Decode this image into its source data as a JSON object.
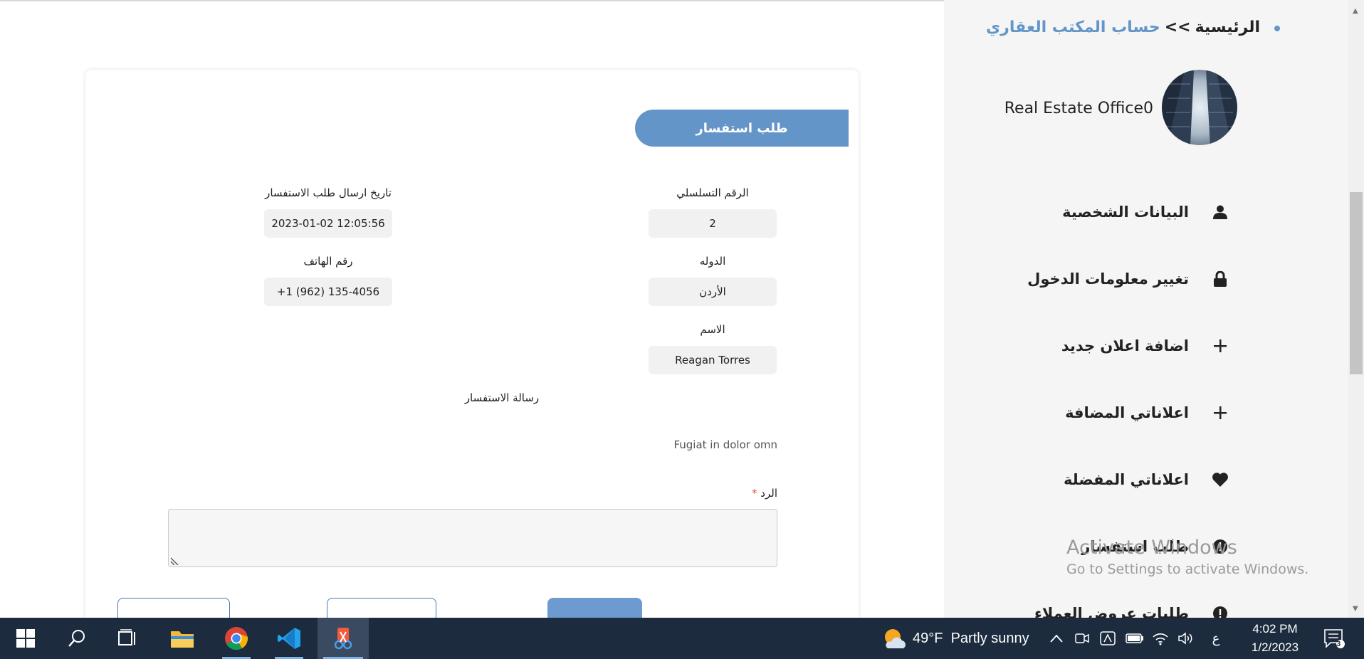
{
  "breadcrumb": {
    "home": "الرئيسية",
    "separator": ">>",
    "current": "حساب المكتب العقاري"
  },
  "profile": {
    "office_name": "Real Estate Office0",
    "avatar_icon": "building-photo"
  },
  "menu": [
    {
      "label": "البيانات الشخصية",
      "icon": "user-icon"
    },
    {
      "label": "تغيير معلومات الدخول",
      "icon": "lock-icon"
    },
    {
      "label": "اضافة اعلان جديد",
      "icon": "plus-icon"
    },
    {
      "label": "اعلاناتي المضافة",
      "icon": "plus-icon"
    },
    {
      "label": "اعلاناتي المفضلة",
      "icon": "heart-icon"
    },
    {
      "label": "طلب استفسار",
      "icon": "info-icon"
    },
    {
      "label": "طلبات عروض العملاء",
      "icon": "info-icon"
    }
  ],
  "inquiry": {
    "tab_title": "طلب استفسار",
    "serial_label": "الرقم التسلسلي",
    "serial_value": "2",
    "date_label": "تاريخ ارسال طلب الاستفسار",
    "date_value": "2023-01-02 12:05:56",
    "country_label": "الدوله",
    "country_value": "الأردن",
    "phone_label": "رقم الهاتف",
    "phone_value": "+1 (962) 135-4056",
    "name_label": "الاسم",
    "name_value": "Reagan Torres",
    "message_label": "رسالة الاستفسار",
    "message_value": "Fugiat in dolor omn",
    "reply_label": "الرد",
    "reply_required": "*"
  },
  "watermark": {
    "title": "Activate Windows",
    "subtitle": "Go to Settings to activate Windows."
  },
  "taskbar": {
    "weather_temp": "49°F",
    "weather_text": "Partly sunny",
    "language": "ع",
    "time": "4:02 PM",
    "date": "1/2/2023",
    "notifications": "3"
  },
  "colors": {
    "accent": "#6495c9",
    "taskbar": "#1c2b3e",
    "sidebar_bg": "#f5f5f5"
  }
}
